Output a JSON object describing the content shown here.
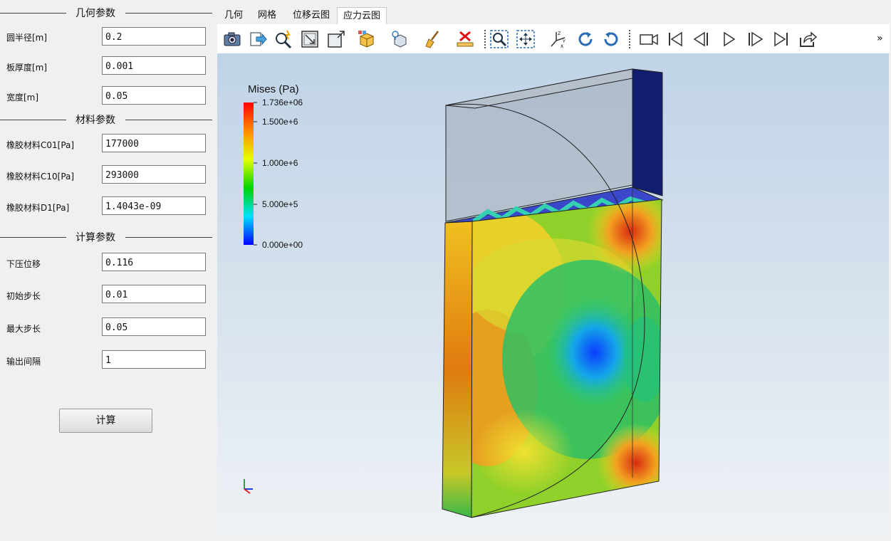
{
  "left_panel": {
    "geometry_title": "几何参数",
    "material_title": "材料参数",
    "compute_title": "计算参数",
    "geometry": [
      {
        "label": "圆半径[m]",
        "value": "0.2"
      },
      {
        "label": "板厚度[m]",
        "value": "0.001"
      },
      {
        "label": "宽度[m]",
        "value": "0.05"
      }
    ],
    "material": [
      {
        "label": "橡胶材料C01[Pa]",
        "value": "177000"
      },
      {
        "label": "橡胶材料C10[Pa]",
        "value": "293000"
      },
      {
        "label": "橡胶材料D1[Pa]",
        "value": "1.4043e-09"
      }
    ],
    "compute": [
      {
        "label": "下压位移",
        "value": "0.116"
      },
      {
        "label": "初始步长",
        "value": "0.01"
      },
      {
        "label": "最大步长",
        "value": "0.05"
      },
      {
        "label": "输出间隔",
        "value": "1"
      }
    ],
    "calc_button": "计算"
  },
  "tabs": [
    "几何",
    "网格",
    "位移云图",
    "应力云图"
  ],
  "active_tab": "应力云图",
  "toolbar": {
    "icons": [
      "camera-icon",
      "export-icon",
      "pick-icon",
      "zoom-box-icon",
      "fit-view-icon",
      "view-cube-icon",
      "display-mode-icon",
      "clean-icon",
      "measure-icon",
      "zoom-region-icon",
      "pan-icon",
      "axes-icon",
      "rotate-cw-icon",
      "rotate-ccw-icon",
      "video-icon",
      "first-frame-icon",
      "prev-frame-icon",
      "play-icon",
      "next-frame-icon",
      "last-frame-icon",
      "share-icon"
    ],
    "overflow": "»"
  },
  "colorbar": {
    "title": "Mises (Pa)",
    "ticks": [
      "1.736e+06",
      "1.500e+6",
      "1.000e+6",
      "5.000e+5",
      "0.000e+00"
    ],
    "colors": [
      "#ff0000",
      "#ffa500",
      "#ffff00",
      "#00d400",
      "#00e5ff",
      "#0000ff"
    ]
  },
  "colors": {
    "accent": "#0a66c2",
    "background_top": "#c0d3e7",
    "background_bottom": "#eef2f6"
  }
}
